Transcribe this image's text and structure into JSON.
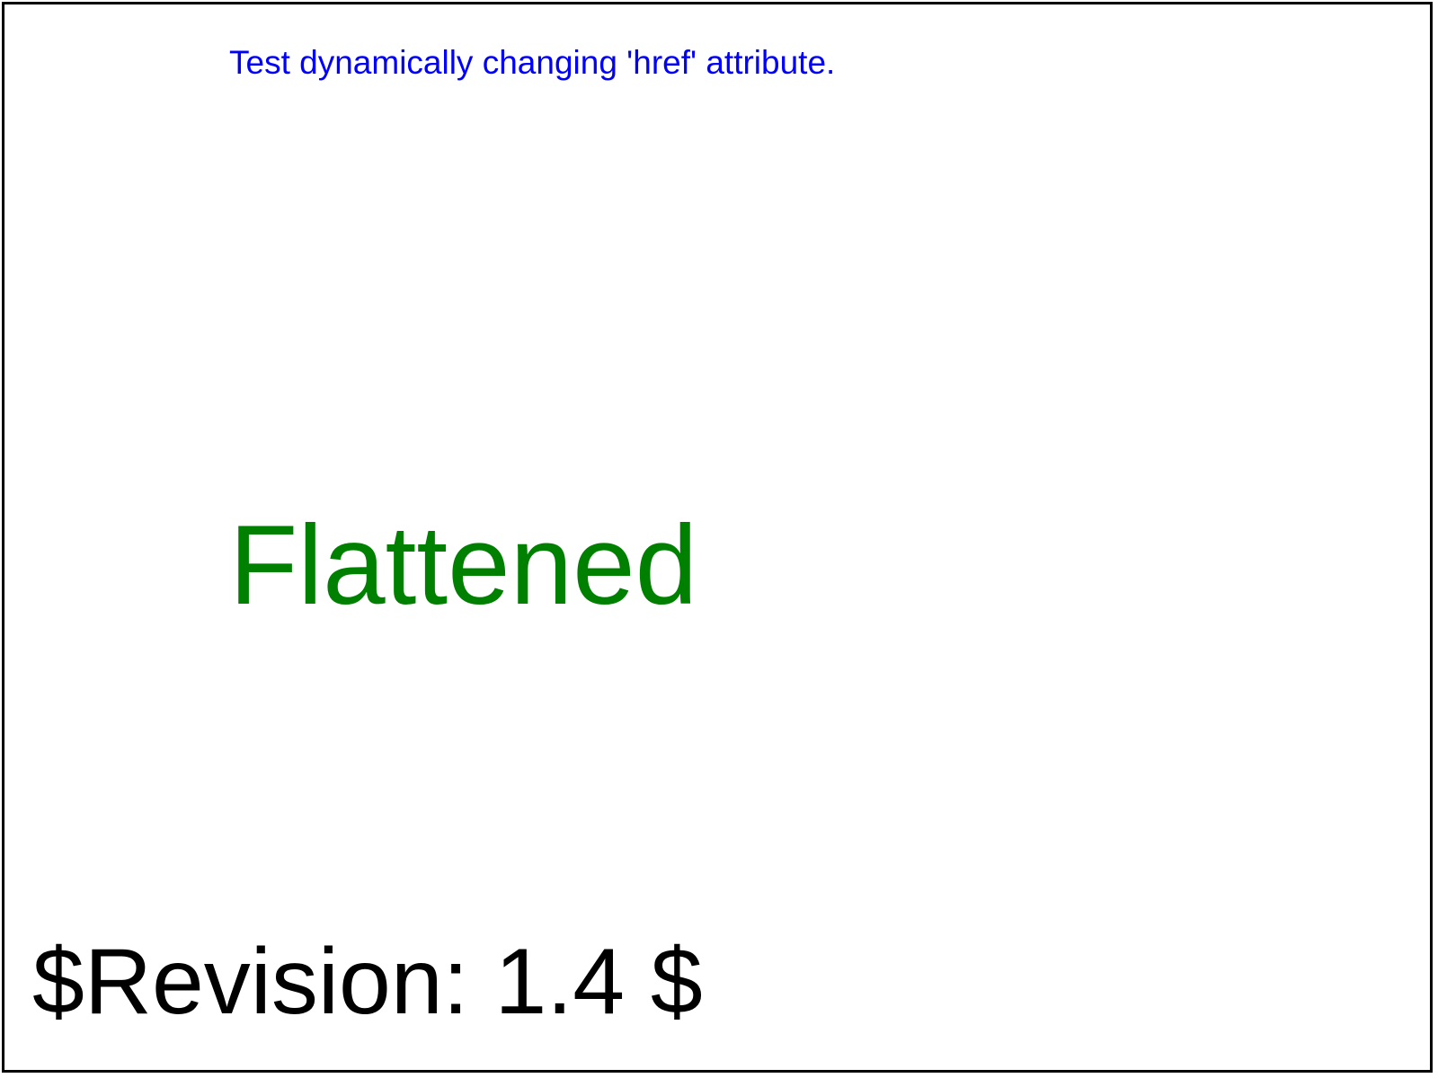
{
  "test": {
    "description": "Test dynamically changing 'href' attribute.",
    "result": "Flattened",
    "revision": "$Revision: 1.4 $"
  },
  "colors": {
    "description": "#0000ff",
    "result": "#008000",
    "revision": "#000000",
    "border": "#000000",
    "background": "#ffffff"
  }
}
